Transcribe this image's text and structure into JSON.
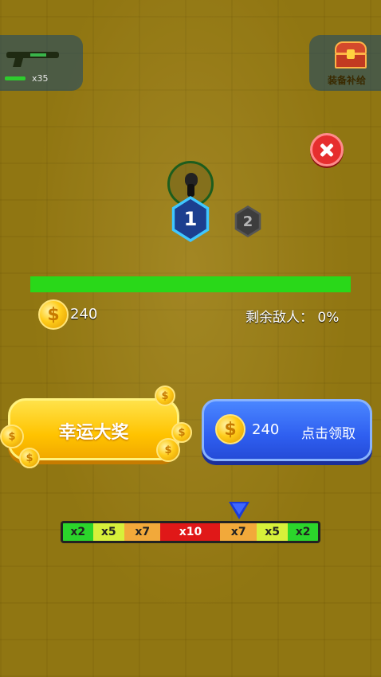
{
  "weapon": {
    "count": "x35",
    "icon": "rifle-icon"
  },
  "chest": {
    "label": "装备补给",
    "icon": "treasure-chest-icon"
  },
  "close": {
    "icon": "close-icon"
  },
  "waves": {
    "current": "1",
    "next": "2"
  },
  "progress": {
    "fraction": 1.0,
    "color": "#29d819"
  },
  "stats": {
    "coins": "240",
    "enemies_label": "剩余敌人：",
    "enemies_value": "0%"
  },
  "lucky": {
    "label": "幸运大奖",
    "color": "#ffc300"
  },
  "claim": {
    "amount": "240",
    "label": "点击领取",
    "color": "#2f5ff0"
  },
  "multipliers": [
    {
      "label": "x2",
      "color": "#2bd52b",
      "weight": 38
    },
    {
      "label": "x5",
      "color": "#d7f03a",
      "weight": 40
    },
    {
      "label": "x7",
      "color": "#f2a93a",
      "weight": 46
    },
    {
      "label": "x10",
      "color": "#e01818",
      "weight": 76
    },
    {
      "label": "x7",
      "color": "#f2a93a",
      "weight": 46
    },
    {
      "label": "x5",
      "color": "#d7f03a",
      "weight": 40
    },
    {
      "label": "x2",
      "color": "#2bd52b",
      "weight": 38
    }
  ]
}
